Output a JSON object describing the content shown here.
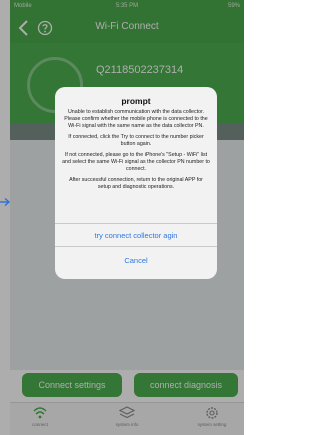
{
  "status_bar": {
    "carrier": "Mobile",
    "time": "5:35 PM",
    "battery": "59%"
  },
  "nav": {
    "title": "Wi-Fi Connect"
  },
  "device": {
    "id": "Q2118502237314"
  },
  "buttons": {
    "connect_settings": "Connect settings",
    "connect_diagnosis": "connect diagnosis"
  },
  "tabs": [
    {
      "label": "connect",
      "icon": "wifi-icon"
    },
    {
      "label": "system info",
      "icon": "layers-icon"
    },
    {
      "label": "system setting",
      "icon": "gear-icon"
    }
  ],
  "dialog": {
    "title": "prompt",
    "messages": [
      "Unable to establish communication with the data collector. Please confirm whether the mobile phone is connected to the Wi-Fi signal with the same name as the data collector PN.",
      "If connected, click the Try to connect to the number picker button again.",
      "If not connected, please go to the iPhone's \"Setup - WiFi\" list and select the same Wi-Fi signal as the collector PN number to connect.",
      "After successful connection, return to the original APP for setup and diagnostic operations."
    ],
    "try_button": "try connect collector agin",
    "cancel_button": "Cancel"
  },
  "colors": {
    "primary_green": "#4caf50",
    "dialog_link_blue": "#2f77e0"
  }
}
